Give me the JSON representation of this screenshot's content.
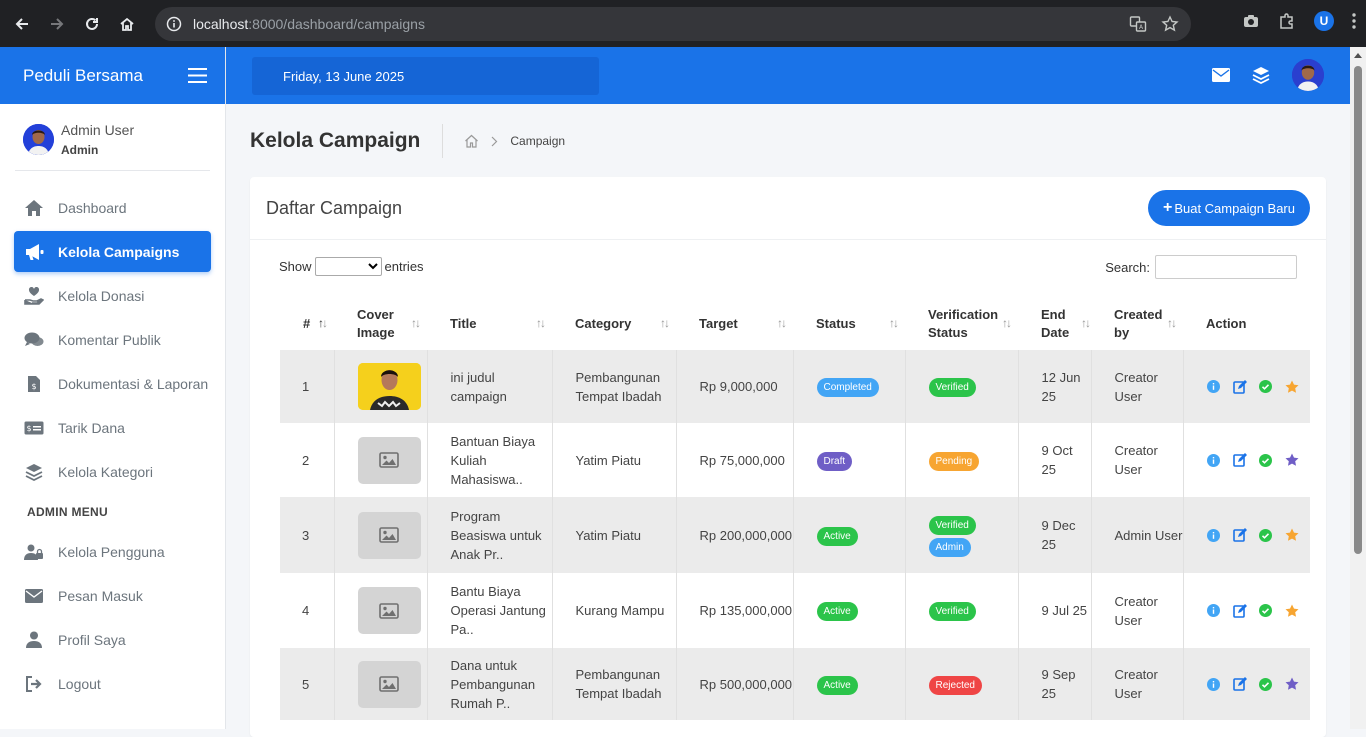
{
  "browser": {
    "url_host": "localhost",
    "url_path": ":8000/dashboard/campaigns",
    "profile_letter": "U"
  },
  "sidebar": {
    "brand": "Peduli Bersama",
    "user_name": "Admin User",
    "user_role": "Admin",
    "items": [
      {
        "label": "Dashboard",
        "icon": "home-icon"
      },
      {
        "label": "Kelola Campaigns",
        "icon": "megaphone-icon",
        "active": true
      },
      {
        "label": "Kelola Donasi",
        "icon": "hand-holding-heart-icon"
      },
      {
        "label": "Komentar Publik",
        "icon": "comments-icon"
      },
      {
        "label": "Dokumentasi & Laporan",
        "icon": "file-invoice-icon"
      },
      {
        "label": "Tarik Dana",
        "icon": "money-check-icon"
      },
      {
        "label": "Kelola Kategori",
        "icon": "layers-icon"
      }
    ],
    "admin_header": "ADMIN MENU",
    "admin_items": [
      {
        "label": "Kelola Pengguna",
        "icon": "users-icon"
      },
      {
        "label": "Pesan Masuk",
        "icon": "envelope-icon"
      },
      {
        "label": "Profil Saya",
        "icon": "user-icon"
      },
      {
        "label": "Logout",
        "icon": "logout-icon"
      }
    ]
  },
  "topbar": {
    "date": "Friday, 13 June 2025"
  },
  "page": {
    "title": "Kelola Campaign",
    "breadcrumb_current": "Campaign"
  },
  "card": {
    "title": "Daftar Campaign",
    "create_button": "Buat Campaign Baru",
    "show_label": "Show",
    "entries_label": "entries",
    "search_label": "Search:",
    "search_value": ""
  },
  "table": {
    "headers": [
      "#",
      "Cover Image",
      "Title",
      "Category",
      "Target",
      "Status",
      "Verification Status",
      "End Date",
      "Created by",
      "Action"
    ],
    "rows": [
      {
        "num": "1",
        "cover": "photo",
        "title": "ini judul campaign",
        "category": "Pembangunan Tempat Ibadah",
        "target": "Rp 9,000,000",
        "status": "Completed",
        "verification": "Verified",
        "verification_extra": "",
        "end_date": "12 Jun 25",
        "created_by": "Creator User",
        "star": "#f7a531"
      },
      {
        "num": "2",
        "cover": "placeholder",
        "title": "Bantuan Biaya Kuliah Mahasiswa..",
        "category": "Yatim Piatu",
        "target": "Rp 75,000,000",
        "status": "Draft",
        "verification": "Pending",
        "verification_extra": "",
        "end_date": "9 Oct 25",
        "created_by": "Creator User",
        "star": "#6f5ec6"
      },
      {
        "num": "3",
        "cover": "placeholder",
        "title": "Program Beasiswa untuk Anak Pr..",
        "category": "Yatim Piatu",
        "target": "Rp 200,000,000",
        "status": "Active",
        "verification": "Verified",
        "verification_extra": "Admin",
        "end_date": "9 Dec 25",
        "created_by": "Admin User",
        "star": "#f7a531"
      },
      {
        "num": "4",
        "cover": "placeholder",
        "title": "Bantu Biaya Operasi Jantung Pa..",
        "category": "Kurang Mampu",
        "target": "Rp 135,000,000",
        "status": "Active",
        "verification": "Verified",
        "verification_extra": "",
        "end_date": "9 Jul 25",
        "created_by": "Creator User",
        "star": "#f7a531"
      },
      {
        "num": "5",
        "cover": "placeholder",
        "title": "Dana untuk Pembangunan Rumah P..",
        "category": "Pembangunan Tempat Ibadah",
        "target": "Rp 500,000,000",
        "status": "Active",
        "verification": "Rejected",
        "verification_extra": "",
        "end_date": "9 Sep 25",
        "created_by": "Creator User",
        "star": "#6f5ec6"
      }
    ]
  },
  "colors": {
    "primary": "#1a73e8",
    "completed": "#42a5f5",
    "draft": "#6f5ec6",
    "active": "#2bc44a",
    "pending": "#f7a531",
    "rejected": "#ef4545"
  }
}
